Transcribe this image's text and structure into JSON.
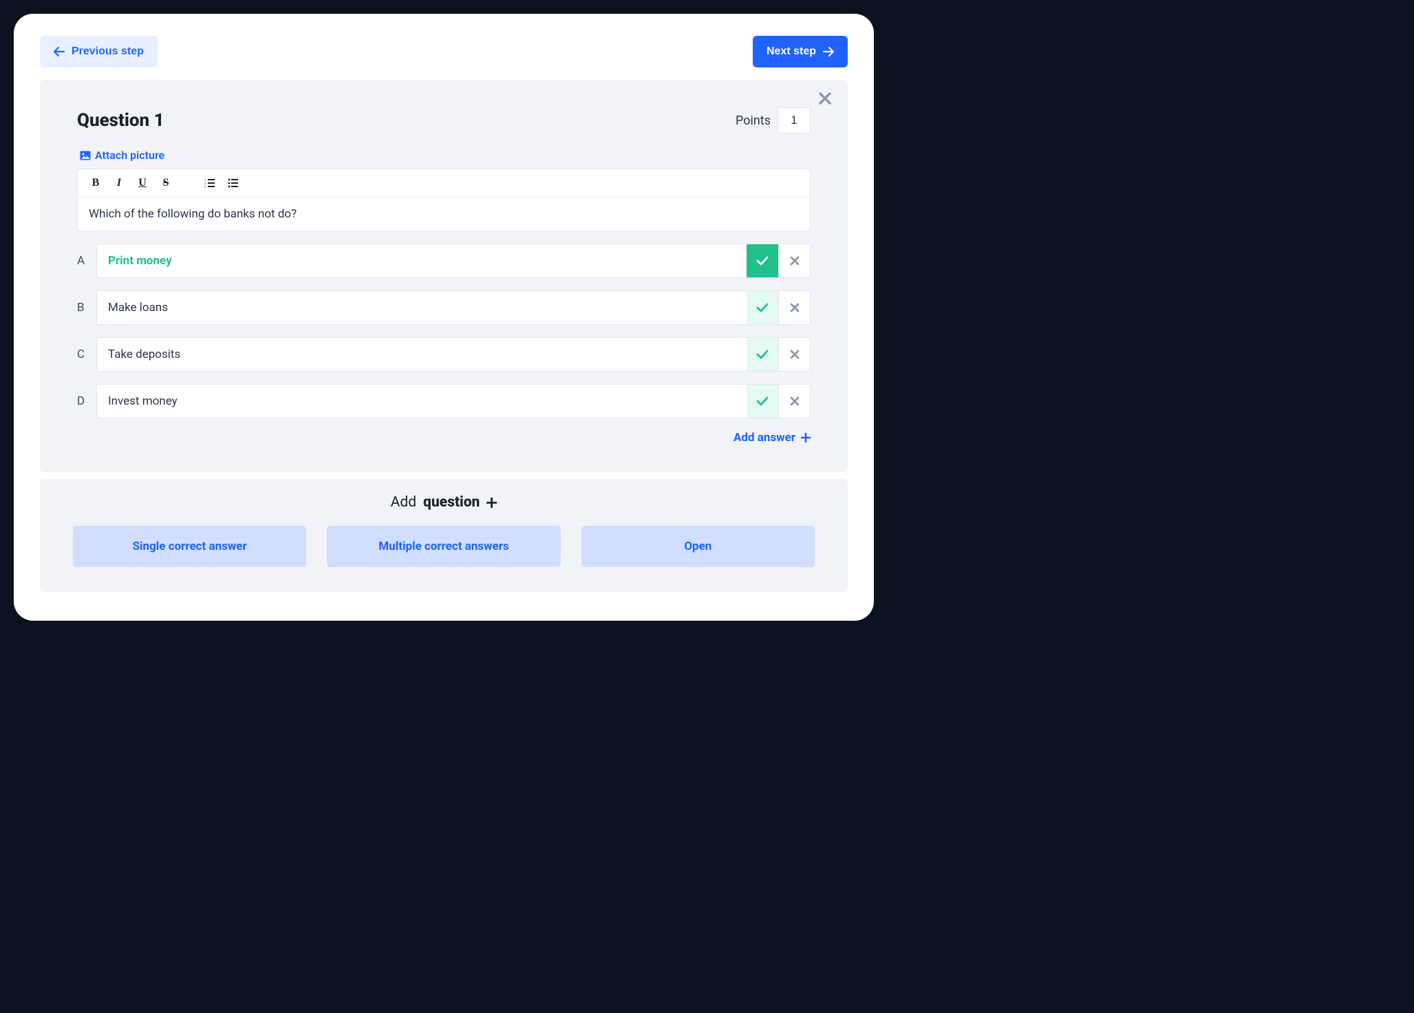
{
  "nav": {
    "prev_label": "Previous step",
    "next_label": "Next step"
  },
  "question": {
    "title": "Question 1",
    "points_label": "Points",
    "points_value": "1",
    "attach_label": "Attach picture",
    "prompt": "Which of the following do banks not do?",
    "answers": [
      {
        "letter": "A",
        "text": "Print money",
        "correct": true
      },
      {
        "letter": "B",
        "text": "Make loans",
        "correct": false
      },
      {
        "letter": "C",
        "text": "Take deposits",
        "correct": false
      },
      {
        "letter": "D",
        "text": "Invest money",
        "correct": false
      }
    ],
    "add_answer_label": "Add answer"
  },
  "add_question": {
    "prefix": "Add",
    "emph": "question",
    "types": {
      "single": "Single correct answer",
      "multiple": "Multiple correct answers",
      "open": "Open"
    }
  }
}
